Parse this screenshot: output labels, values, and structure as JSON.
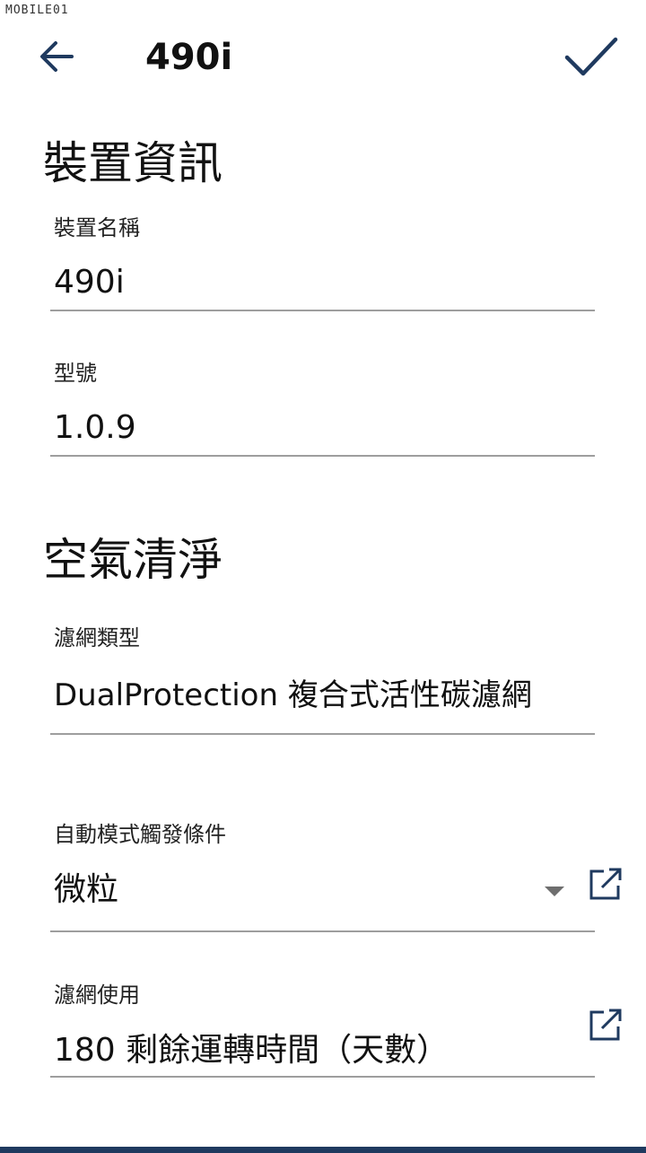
{
  "watermark": "MOBILE01",
  "header": {
    "title": "490i"
  },
  "sections": {
    "device_info": {
      "title": "裝置資訊",
      "name_label": "裝置名稱",
      "name_value": "490i",
      "model_label": "型號",
      "model_value": "1.0.9"
    },
    "air_purify": {
      "title": "空氣清淨",
      "filter_type_label": "濾網類型",
      "filter_type_value": "DualProtection 複合式活性碳濾網",
      "auto_trigger_label": "自動模式觸發條件",
      "auto_trigger_value": "微粒",
      "filter_usage_label": "濾網使用",
      "filter_usage_value": "180 剩餘運轉時間（天數）"
    }
  },
  "colors": {
    "accent": "#1f3a5f",
    "underline": "#9e9e9e"
  },
  "icons": {
    "back": "arrow-left-icon",
    "confirm": "checkmark-icon",
    "external": "external-link-icon",
    "dropdown": "chevron-down-icon"
  }
}
